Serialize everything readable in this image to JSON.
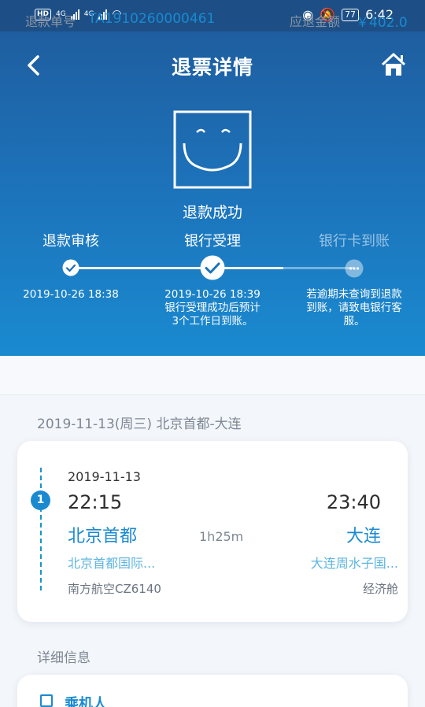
{
  "status_bar": {
    "left_badge": "HD",
    "net1": "4G",
    "net2": "4G",
    "battery": "77",
    "time": "6:42"
  },
  "nav": {
    "title": "退票详情",
    "back_icon": "chevron-left-icon",
    "home_icon": "home-icon"
  },
  "result": {
    "icon": "smiley-face-icon",
    "text": "退款成功"
  },
  "progress": {
    "steps": [
      {
        "label": "退款审核",
        "time": "2019-10-26 18:38",
        "note": "",
        "done": true
      },
      {
        "label": "银行受理",
        "time": "2019-10-26 18:39",
        "note": "银行受理成功后预计3个工作日到账。",
        "done": true
      },
      {
        "label": "银行卡到账",
        "time": "",
        "note": "若逾期未查询到退款到账，请致电银行客服。",
        "done": false
      }
    ]
  },
  "refund": {
    "no_label": "退款单号",
    "no_value": "TA1910260000461",
    "amount_label": "应退金额",
    "amount_value": "￥402.0"
  },
  "trip": {
    "title": "2019-11-13(周三) 北京首都-大连",
    "segment_no": "1",
    "date": "2019-11-13",
    "dep_time": "22:15",
    "arr_time": "23:40",
    "dep_city": "北京首都",
    "arr_city": "大连",
    "duration": "1h25m",
    "dep_airport": "北京首都国际...",
    "arr_airport": "大连周水子国...",
    "airline": "南方航空CZ6140",
    "cabin": "经济舱"
  },
  "details": {
    "title": "详细信息",
    "passenger_label": "乘机人"
  },
  "colors": {
    "accent": "#1a8ad0",
    "header_top": "#1f5a9a"
  }
}
